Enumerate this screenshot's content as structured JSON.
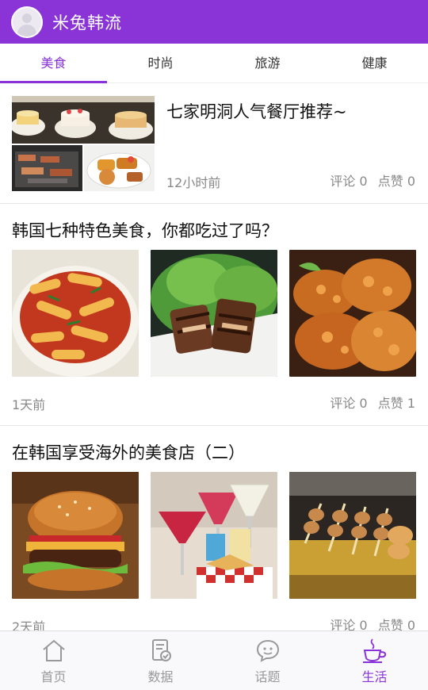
{
  "app": {
    "title": "米兔韩流",
    "accent": "#8a34d8"
  },
  "tabs": [
    {
      "label": "美食",
      "active": true
    },
    {
      "label": "时尚",
      "active": false
    },
    {
      "label": "旅游",
      "active": false
    },
    {
      "label": "健康",
      "active": false
    }
  ],
  "articles": [
    {
      "title": "七家明洞人气餐厅推荐~",
      "time": "12小时前",
      "comments_label": "评论",
      "comments": "0",
      "likes_label": "点赞",
      "likes": "0",
      "images": [
        "cake-buffet",
        "grilled-meat",
        "fried-dish"
      ]
    },
    {
      "title": "韩国七种特色美食，你都吃过了吗？",
      "time": "1天前",
      "comments_label": "评论",
      "comments": "0",
      "likes_label": "点赞",
      "likes": "1",
      "images": [
        "tteokbokki",
        "grilled-pork",
        "fried-chicken"
      ]
    },
    {
      "title": "在韩国享受海外的美食店（二）",
      "time": "2天前",
      "comments_label": "评论",
      "comments": "0",
      "likes_label": "点赞",
      "likes": "0",
      "images": [
        "burger",
        "cocktails",
        "skewers"
      ]
    }
  ],
  "bottom_nav": [
    {
      "label": "首页",
      "icon": "home-icon",
      "active": false
    },
    {
      "label": "数据",
      "icon": "document-icon",
      "active": false
    },
    {
      "label": "话题",
      "icon": "chat-icon",
      "active": false
    },
    {
      "label": "生活",
      "icon": "coffee-cup-icon",
      "active": true
    }
  ]
}
